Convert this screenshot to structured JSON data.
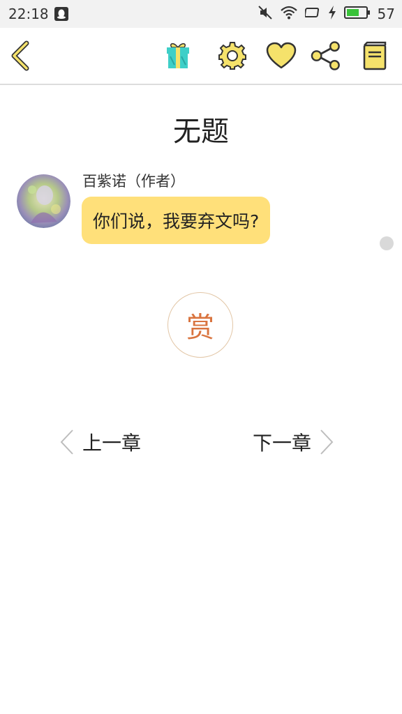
{
  "status_bar": {
    "time": "22:18",
    "battery_percent": "57",
    "battery_color": "#39c239"
  },
  "toolbar": {
    "icons": [
      "back-chevron-icon",
      "gift-icon",
      "gear-icon",
      "heart-icon",
      "share-icon",
      "book-icon"
    ],
    "accent_fill": "#f5e26b",
    "stroke": "#333333"
  },
  "chapter": {
    "title": "无题"
  },
  "message": {
    "author": "百紫诺（作者）",
    "text": "你们说，我要弃文吗?",
    "bubble_color": "#ffe07a"
  },
  "tip": {
    "label": "赏",
    "color": "#d9743f"
  },
  "navigation": {
    "prev_label": "上一章",
    "next_label": "下一章"
  }
}
